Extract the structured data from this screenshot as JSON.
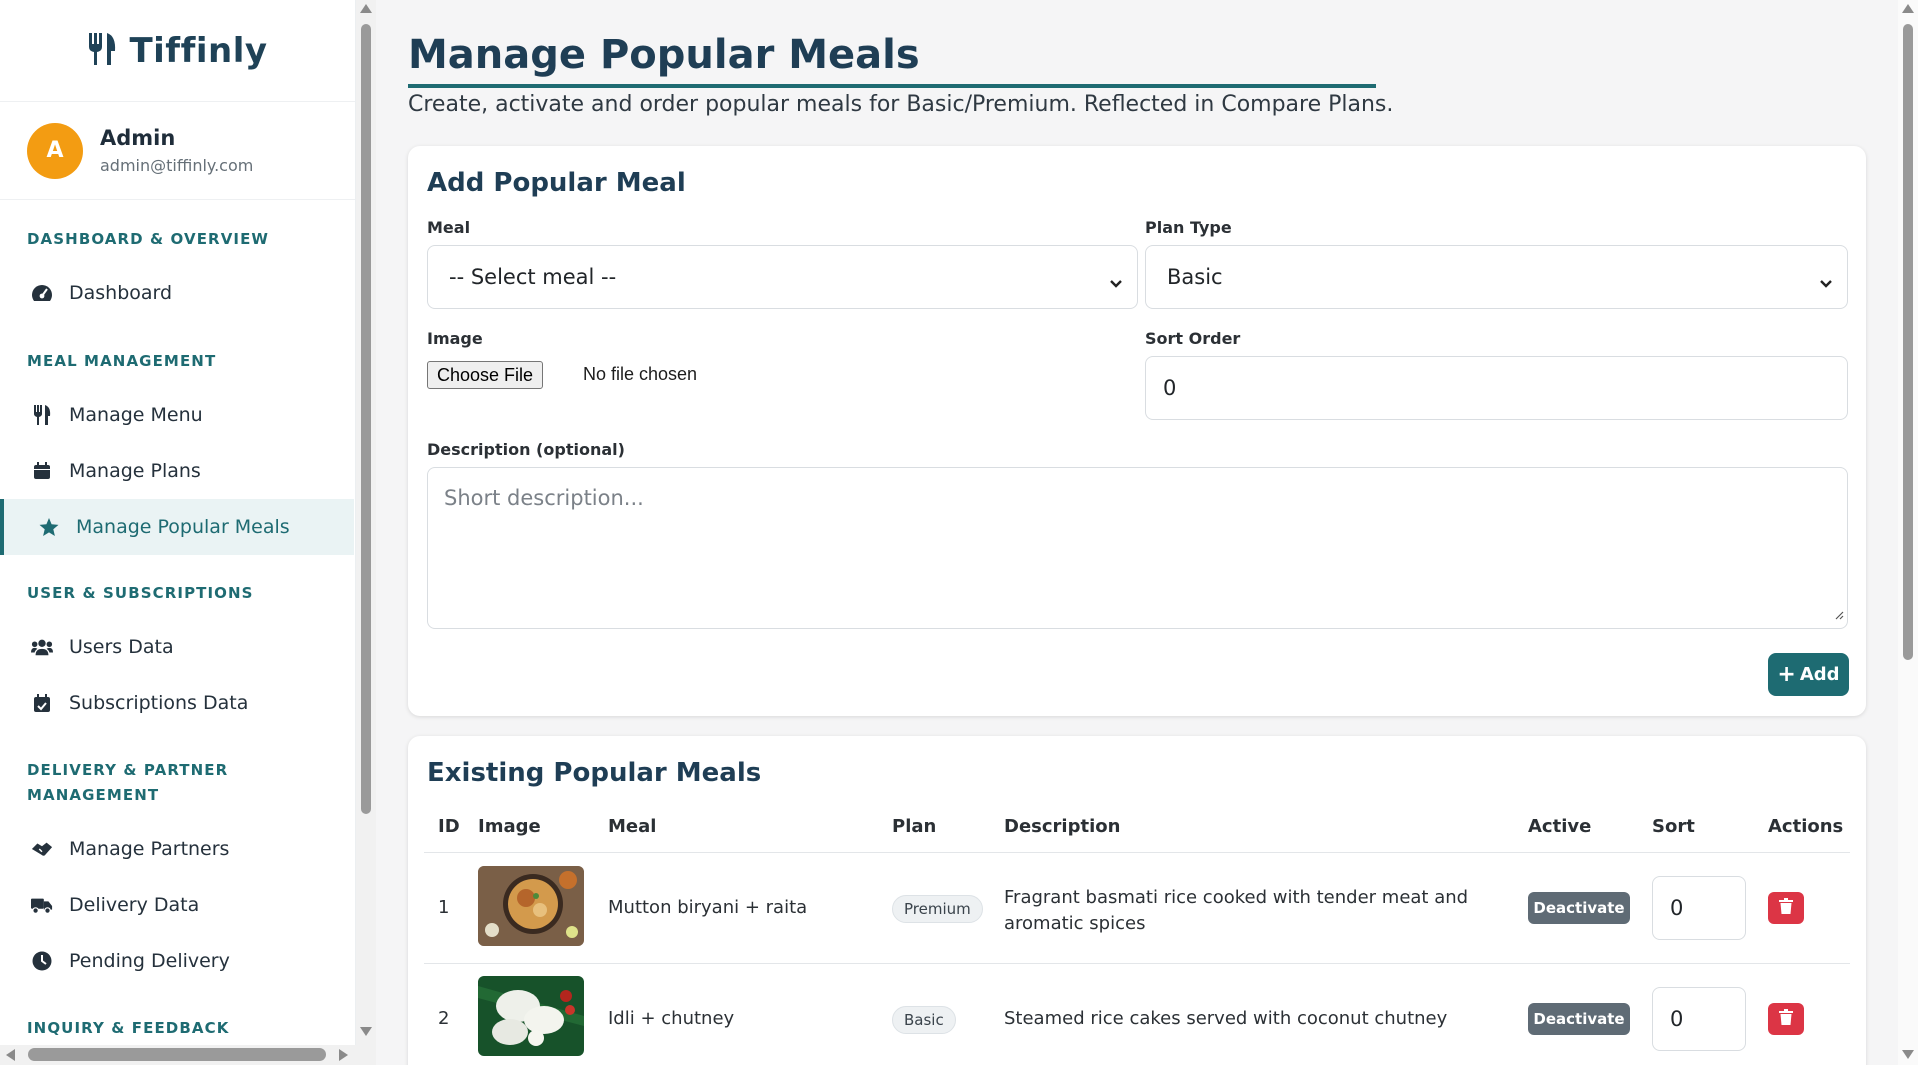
{
  "brand": {
    "name": "Tiffinly",
    "icon": "utensils-icon"
  },
  "user": {
    "initial": "A",
    "name": "Admin",
    "email": "admin@tiffinly.com"
  },
  "sidebar": {
    "sections": [
      {
        "title": "DASHBOARD & OVERVIEW"
      },
      {
        "title": "MEAL MANAGEMENT"
      },
      {
        "title": "USER & SUBSCRIPTIONS"
      },
      {
        "title": "DELIVERY & PARTNER",
        "title2": "MANAGEMENT"
      },
      {
        "title": "INQUIRY & FEEDBACK"
      }
    ],
    "items": [
      {
        "label": "Dashboard",
        "icon": "gauge-icon"
      },
      {
        "label": "Manage Menu",
        "icon": "utensils-icon"
      },
      {
        "label": "Manage Plans",
        "icon": "calendar-icon"
      },
      {
        "label": "Manage Popular Meals",
        "icon": "star-icon",
        "active": true
      },
      {
        "label": "Users Data",
        "icon": "users-icon"
      },
      {
        "label": "Subscriptions Data",
        "icon": "calendar-check-icon"
      },
      {
        "label": "Manage Partners",
        "icon": "handshake-icon"
      },
      {
        "label": "Delivery Data",
        "icon": "truck-icon"
      },
      {
        "label": "Pending Delivery",
        "icon": "clock-icon"
      }
    ]
  },
  "page": {
    "title": "Manage Popular Meals",
    "subtitle": "Create, activate and order popular meals for Basic/Premium. Reflected in Compare Plans."
  },
  "add_form": {
    "title": "Add Popular Meal",
    "meal_label": "Meal",
    "meal_value": "-- Select meal --",
    "plan_label": "Plan Type",
    "plan_value": "Basic",
    "image_label": "Image",
    "file_button": "Choose File",
    "file_status": "No file chosen",
    "sort_label": "Sort Order",
    "sort_value": "0",
    "desc_label": "Description (optional)",
    "desc_placeholder": "Short description...",
    "add_button": "Add"
  },
  "table": {
    "title": "Existing Popular Meals",
    "headers": [
      "ID",
      "Image",
      "Meal",
      "Plan",
      "Description",
      "Active",
      "Sort",
      "Actions"
    ],
    "rows": [
      {
        "id": "1",
        "meal": "Mutton biryani + raita",
        "plan": "Premium",
        "description_line1": "Fragrant basmati rice cooked with tender meat and",
        "description_line2": "aromatic spices",
        "active_button": "Deactivate",
        "sort": "0"
      },
      {
        "id": "2",
        "meal": "Idli + chutney",
        "plan": "Basic",
        "description_line1": "Steamed rice cakes served with coconut chutney",
        "description_line2": "",
        "active_button": "Deactivate",
        "sort": "0"
      }
    ]
  },
  "colors": {
    "accent": "#1e6b72",
    "heading": "#1f3e55",
    "avatar": "#f39c12",
    "danger": "#dc3545",
    "muted_button": "#5f6b75"
  }
}
